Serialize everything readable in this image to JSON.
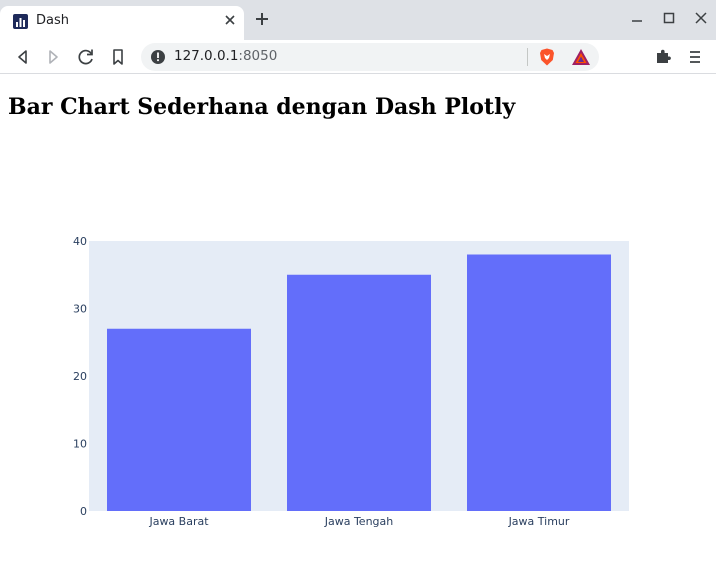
{
  "browser": {
    "tab_title": "Dash",
    "url_host": "127.0.0.1",
    "url_port": ":8050",
    "colors": {
      "tabbar_bg": "#dee1e6",
      "omnibox_bg": "#f1f3f4"
    }
  },
  "page": {
    "title": "Bar Chart Sederhana dengan Dash Plotly"
  },
  "chart_data": {
    "type": "bar",
    "title": "",
    "xlabel": "",
    "ylabel": "",
    "categories": [
      "Jawa Barat",
      "Jawa Tengah",
      "Jawa Timur"
    ],
    "values": [
      27,
      35,
      38
    ],
    "ylim": [
      0,
      40
    ],
    "yticks": [
      0,
      10,
      20,
      30,
      40
    ],
    "grid": false,
    "legend": "none",
    "bar_color": "#636efa",
    "plot_bg": "#e5ecf6"
  }
}
